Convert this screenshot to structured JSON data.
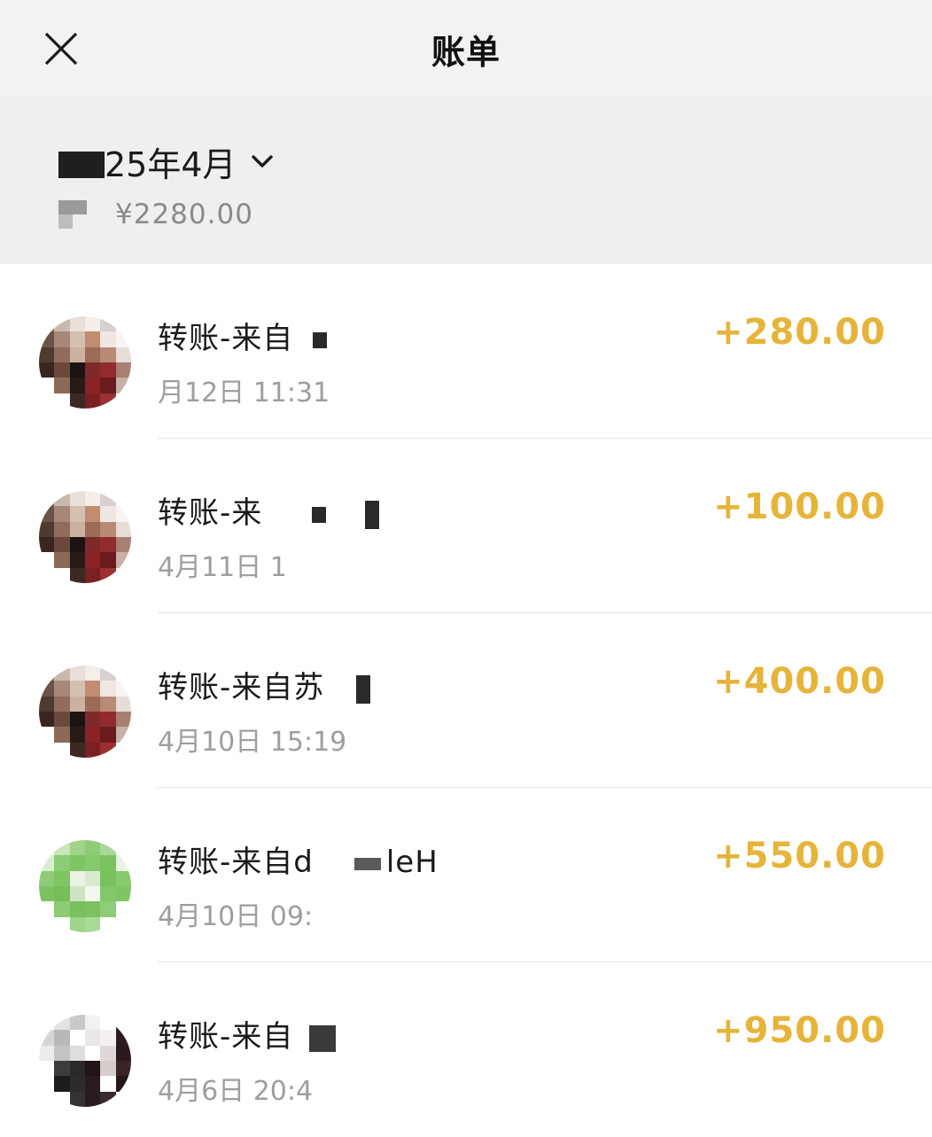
{
  "header": {
    "title": "账单",
    "close_icon": "close-icon"
  },
  "summary": {
    "month_label": "25年4月",
    "income_label": "¥2280.00",
    "chevron_icon": "chevron-down-icon"
  },
  "colors": {
    "amount": "#e6b43a",
    "header_bg": "#f2f2f2",
    "summary_bg": "#efefef"
  },
  "transactions": [
    {
      "title": "转账-来自",
      "time": "月12日 11:31",
      "amount": "+280.00",
      "avatar": [
        "#8a7062",
        "#c9b8ad",
        "#e9dfd8",
        "#f3eee9",
        "#d8cfd0",
        "#ffffff",
        "#6b5347",
        "#a58877",
        "#d6bfae",
        "#c18c6f",
        "#f1e7e2",
        "#f5f5f5",
        "#4d3a31",
        "#8f6d5d",
        "#cdb19f",
        "#9b6b57",
        "#b98978",
        "#e8dcd6",
        "#3a2620",
        "#6b4a3d",
        "#1d1411",
        "#7f2a2a",
        "#912b2f",
        "#a97f73",
        "#ffffff",
        "#8c6a5a",
        "#2a1a16",
        "#8a2227",
        "#6b1b1f",
        "#c9b0a4",
        "#ffffff",
        "#ffffff",
        "#3d2823",
        "#7a2024",
        "#9b3033",
        "#ffffff"
      ]
    },
    {
      "title": "转账-来",
      "time": "4月11日 1",
      "amount": "+100.00",
      "avatar": [
        "#8a7062",
        "#c9b8ad",
        "#e9dfd8",
        "#f3eee9",
        "#d8cfd0",
        "#ffffff",
        "#6b5347",
        "#a58877",
        "#d6bfae",
        "#c18c6f",
        "#f1e7e2",
        "#f5f5f5",
        "#4d3a31",
        "#8f6d5d",
        "#cdb19f",
        "#9b6b57",
        "#b98978",
        "#e8dcd6",
        "#3a2620",
        "#6b4a3d",
        "#1d1411",
        "#7f2a2a",
        "#912b2f",
        "#a97f73",
        "#ffffff",
        "#8c6a5a",
        "#2a1a16",
        "#8a2227",
        "#6b1b1f",
        "#c9b0a4",
        "#ffffff",
        "#ffffff",
        "#3d2823",
        "#7a2024",
        "#9b3033",
        "#ffffff"
      ]
    },
    {
      "title": "转账-来自苏",
      "time": "4月10日 15:19",
      "amount": "+400.00",
      "avatar": [
        "#8a7062",
        "#c9b8ad",
        "#e9dfd8",
        "#f3eee9",
        "#d8cfd0",
        "#ffffff",
        "#6b5347",
        "#a58877",
        "#d6bfae",
        "#c18c6f",
        "#f1e7e2",
        "#f5f5f5",
        "#4d3a31",
        "#8f6d5d",
        "#cdb19f",
        "#9b6b57",
        "#b98978",
        "#e8dcd6",
        "#3a2620",
        "#6b4a3d",
        "#1d1411",
        "#7f2a2a",
        "#912b2f",
        "#a97f73",
        "#ffffff",
        "#8c6a5a",
        "#2a1a16",
        "#8a2227",
        "#6b1b1f",
        "#c9b0a4",
        "#ffffff",
        "#ffffff",
        "#3d2823",
        "#7a2024",
        "#9b3033",
        "#ffffff"
      ]
    },
    {
      "title": "转账-来自d",
      "title_suffix": "leH",
      "time": "4月10日 09:",
      "amount": "+550.00",
      "avatar": [
        "#ffffff",
        "#c8e6b7",
        "#9fd48a",
        "#8fcc77",
        "#a8d996",
        "#ffffff",
        "#d9efcc",
        "#8ccc74",
        "#7fc564",
        "#86c86d",
        "#7cc262",
        "#e7f4df",
        "#8fcc77",
        "#7fc564",
        "#e9f2e3",
        "#d8ead0",
        "#79c15e",
        "#88c96f",
        "#7cc262",
        "#75be59",
        "#cfe3c4",
        "#f3f8ef",
        "#84c66a",
        "#7fc564",
        "#ffffff",
        "#8dcb74",
        "#79c15e",
        "#7cc262",
        "#8fcc77",
        "#ffffff",
        "#ffffff",
        "#ffffff",
        "#9fd48a",
        "#a8d996",
        "#ffffff",
        "#ffffff"
      ]
    },
    {
      "title": "转账-来自",
      "time": "4月6日 20:4",
      "amount": "+950.00",
      "avatar": [
        "#ffffff",
        "#e3e3e3",
        "#c9c9c9",
        "#f2f2f2",
        "#ffffff",
        "#3a2a2a",
        "#d6d6d6",
        "#b8b8b8",
        "#ffffff",
        "#e8e8e8",
        "#f5f0f0",
        "#2b1b1f",
        "#ececec",
        "#c4c4c4",
        "#dedede",
        "#ffffff",
        "#e0d8d8",
        "#2a1a1e",
        "#ffffff",
        "#3d3d3d",
        "#2a2a2a",
        "#1f1416",
        "#d6cccc",
        "#3a2327",
        "#ffffff",
        "#1c1c1c",
        "#2c2c2c",
        "#2b1b20",
        "#ffffff",
        "#241519",
        "#ffffff",
        "#ffffff",
        "#333333",
        "#2a1b1f",
        "#3c2a2e",
        "#ffffff"
      ]
    }
  ]
}
